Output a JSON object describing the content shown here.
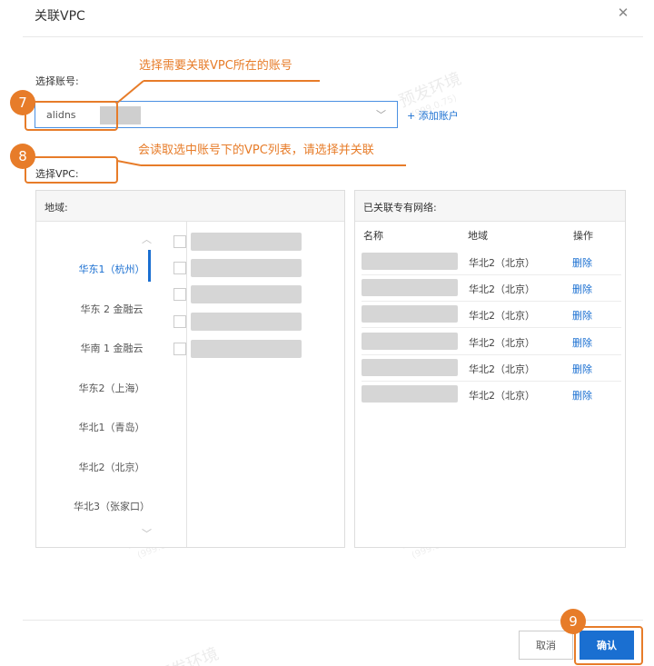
{
  "dialog": {
    "title": "关联VPC",
    "close_icon": "close-icon"
  },
  "account": {
    "label": "选择账号:",
    "value": "alidns",
    "add_link": "+ 添加账户"
  },
  "vpc": {
    "label": "选择VPC:"
  },
  "region_panel": {
    "header": "地域:",
    "regions": [
      {
        "label": "华东1（杭州）",
        "active": true
      },
      {
        "label": "华东 2 金融云"
      },
      {
        "label": "华南 1 金融云"
      },
      {
        "label": "华东2（上海）"
      },
      {
        "label": "华北1（青岛）"
      },
      {
        "label": "华北2（北京）"
      },
      {
        "label": "华北3（张家口）"
      }
    ]
  },
  "linked_panel": {
    "header": "已关联专有网络:",
    "columns": [
      "名称",
      "地域",
      "操作"
    ],
    "rows": [
      {
        "region": "华北2（北京）",
        "action": "删除"
      },
      {
        "region": "华北2（北京）",
        "action": "删除"
      },
      {
        "region": "华北2（北京）",
        "action": "删除"
      },
      {
        "region": "华北2（北京）",
        "action": "删除"
      },
      {
        "region": "华北2（北京）",
        "action": "删除"
      },
      {
        "region": "华北2（北京）",
        "action": "删除"
      }
    ]
  },
  "footer": {
    "cancel": "取消",
    "confirm": "确认"
  },
  "annotations": {
    "step7": "7",
    "step7_text": "选择需要关联VPC所在的账号",
    "step8": "8",
    "step8_text": "会读取选中账号下的VPC列表，请选择并关联",
    "step9": "9",
    "color": "#e77c29"
  },
  "watermark": {
    "text": "预发环境",
    "sub": "(999.0.75)"
  }
}
